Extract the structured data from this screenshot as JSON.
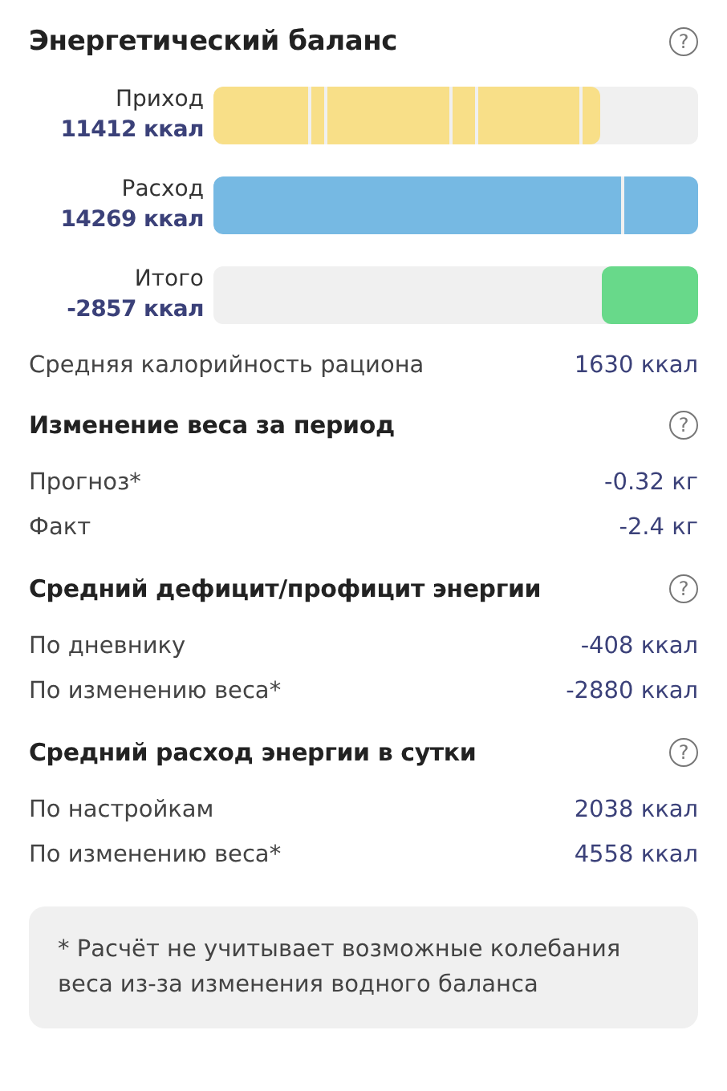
{
  "title": "Энергетический баланс",
  "help": "?",
  "bars": [
    {
      "label": "Приход",
      "value": "11412 ккал",
      "kind": "stacked",
      "color": "#f8df88"
    },
    {
      "label": "Расход",
      "value": "14269 ккал",
      "kind": "stacked",
      "color": "#76b9e3",
      "segments": [
        {
          "level": 0.841
        },
        {
          "level": 0.159
        }
      ]
    },
    {
      "label": "Итого",
      "value": "-2857 ккал",
      "kind": "end",
      "color": "#68d98a",
      "segments": [
        {
          "level": 0.199
        }
      ]
    }
  ],
  "summary": {
    "label": "Средняя калорийность рациона",
    "value": "1630 ккал"
  },
  "sections": [
    {
      "title": "Изменение веса за период",
      "help": "?",
      "rows": [
        {
          "label": "Прогноз*",
          "value": "-0.32 кг"
        },
        {
          "label": "Факт",
          "value": "-2.4 кг"
        }
      ]
    },
    {
      "title": "Средний дефицит/профицит энергии",
      "help": "?",
      "rows": [
        {
          "label": "По дневнику",
          "value": "-408 ккал"
        },
        {
          "label": "По изменению веса*",
          "value": "-2880 ккал"
        }
      ]
    },
    {
      "title": "Средний расход энергии в сутки",
      "help": "?",
      "rows": [
        {
          "label": "По настройкам",
          "value": "2038 ккал"
        },
        {
          "label": "По изменению веса*",
          "value": "4558 ккал"
        }
      ]
    }
  ],
  "footnote": "* Расчёт не учитывает возможные колебания веса из-за изменения водного баланса"
}
